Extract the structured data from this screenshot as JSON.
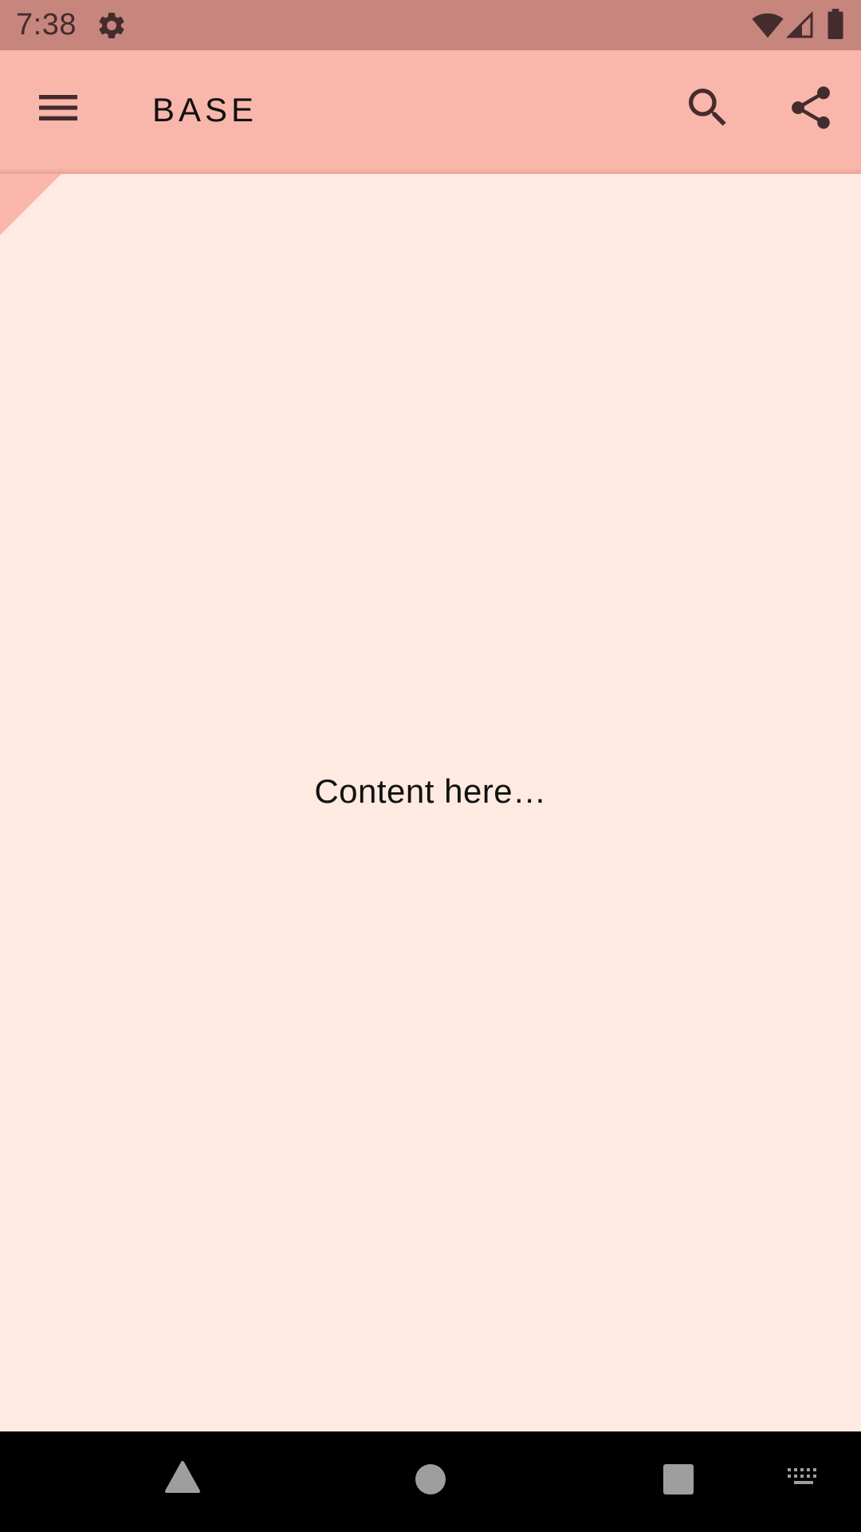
{
  "status_bar": {
    "time": "7:38",
    "icons": [
      "gear-icon",
      "wifi-icon",
      "cell-signal-icon",
      "battery-icon"
    ]
  },
  "app_bar": {
    "title": "BASE",
    "icons": [
      "menu-icon",
      "search-icon",
      "share-icon"
    ]
  },
  "content": {
    "text": "Content here…"
  },
  "nav_bar": {
    "icons": [
      "back-icon",
      "home-icon",
      "recents-icon",
      "keyboard-icon"
    ]
  },
  "colors": {
    "status_bar": "#C6857D",
    "app_bar": "#F9B6AA",
    "background": "#FEEAE0",
    "icon": "#442C2E",
    "nav_bar": "#000000",
    "nav_icon": "#9E9E9E"
  }
}
